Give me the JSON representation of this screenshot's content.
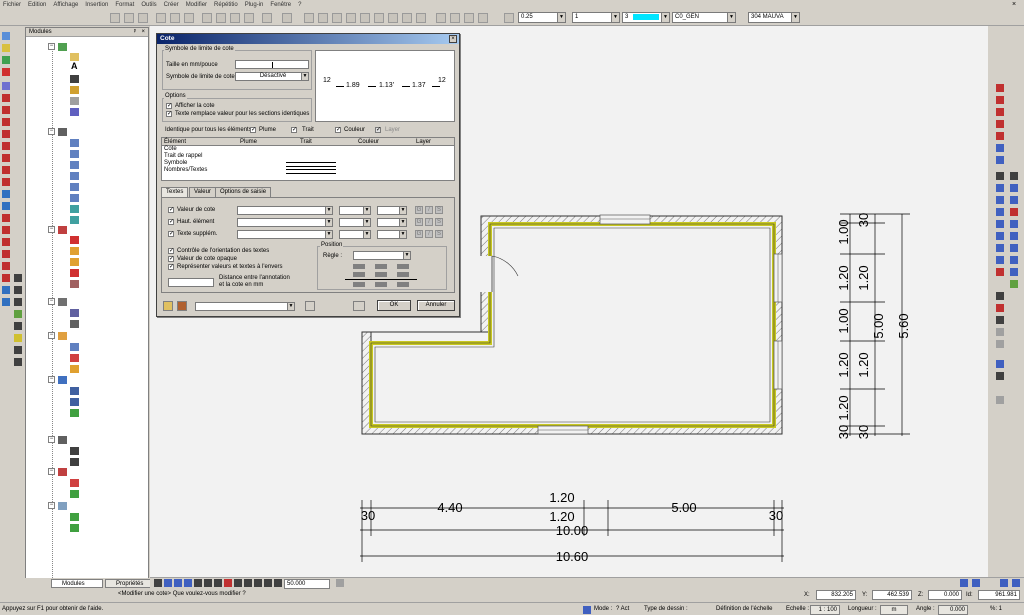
{
  "menu": [
    "Fichier",
    "Edition",
    "Affichage",
    "Insertion",
    "Format",
    "Outils",
    "Créer",
    "Modifier",
    "Répétitio",
    "Plug-in",
    "Fenêtre",
    "?"
  ],
  "toolbar": {
    "pen_value": "0.25",
    "line_value": "1",
    "color_value": "3",
    "layer_value": "C0_GEN",
    "ref_value": "304 MAUVA",
    "color_accent": "#00e5ff"
  },
  "modules": {
    "title": "Modules",
    "tab_modules": "Modules",
    "tab_properties": "Propriétés"
  },
  "dialog": {
    "title": "Cote",
    "group_symbol": "Symbole de limite de cote",
    "size_label": "Taille en mm/pouce",
    "symbol_label": "Symbole de limite de cote",
    "symbol_value": "Désactivé",
    "preview": {
      "left": "12",
      "v1": "1.89",
      "v2": "1.13'",
      "v3": "1.37",
      "right": "12"
    },
    "group_options": "Options",
    "opt_show": "Afficher la cote",
    "opt_replace": "Texte remplace valeur pour les sections identiques",
    "identical_label": "Identique pour tous les éléments",
    "id_pen": "Plume",
    "id_line": "Trait",
    "id_color": "Couleur",
    "id_layer": "Layer",
    "table_headers": [
      "Élément",
      "Plume",
      "Trait",
      "Couleur",
      "Layer"
    ],
    "table_rows": [
      "Cote",
      "Trait de rappel",
      "Symbole",
      "Nombres/Textes"
    ],
    "tabs": [
      "Textes",
      "Valeur",
      "Options de saisie"
    ],
    "text_rows": [
      "Valeur de cote",
      "Haut. élément",
      "Texte supplém."
    ],
    "g_label": "G",
    "s_label": "S",
    "chk_orient": "Contrôle de l'orientation des textes",
    "chk_opaque": "Valeur de cote opaque",
    "chk_reverse": "Représenter valeurs et textes à l'envers",
    "position_label": "Position",
    "rule_label": "Règle :",
    "distance_label_1": "Distance entre l'annotation",
    "distance_label_2": "et la cote en mm",
    "ok": "OK",
    "cancel": "Annuler"
  },
  "drawing": {
    "dims_vertical": [
      "30",
      "1.00",
      "1.20",
      "1.20",
      "1.00",
      "5.00",
      "5.60",
      "1.20",
      "1.20",
      "1.20",
      "30",
      "30"
    ],
    "v_30_top": "30",
    "v_100_a": "1.00",
    "v_120_a": "1.20",
    "v_120_b": "1.20",
    "v_100_b": "1.00",
    "v_500": "5.00",
    "v_560": "5.60",
    "v_120_c": "1.20",
    "v_120_d": "1.20",
    "v_120_e": "1.20",
    "v_30_b1": "30",
    "v_30_b2": "30",
    "h_30_left": "30",
    "h_440": "4.40",
    "h_120_top": "1.20",
    "h_500": "5.00",
    "h_30_right": "30",
    "h_120_bot": "1.20",
    "h_1000": "10.00",
    "h_1060": "10.60"
  },
  "navbar": {
    "zoom_value": "50.000"
  },
  "coords": {
    "x_label": "X:",
    "x_value": "832.205",
    "y_label": "Y:",
    "y_value": "462.539",
    "z_label": "Z:",
    "z_value": "0.000",
    "id_label": "Id:",
    "id_value": "961.981"
  },
  "status": {
    "help": "Appuyez sur F1 pour obtenir de l'aide.",
    "prompt": "<Modifier une cote> Que voulez-vous modifier ?",
    "mode_label": "Mode :",
    "mode_value": "? Act",
    "draw_type_label": "Type de dessin :",
    "scale_def": "Définition de l'échelle",
    "scale_label": "Echelle :",
    "scale_value": "1 : 100",
    "length_label": "Longueur :",
    "length_unit": "m",
    "angle_label": "Angle :",
    "angle_value": "0.000",
    "pct_label": "%: 1"
  }
}
